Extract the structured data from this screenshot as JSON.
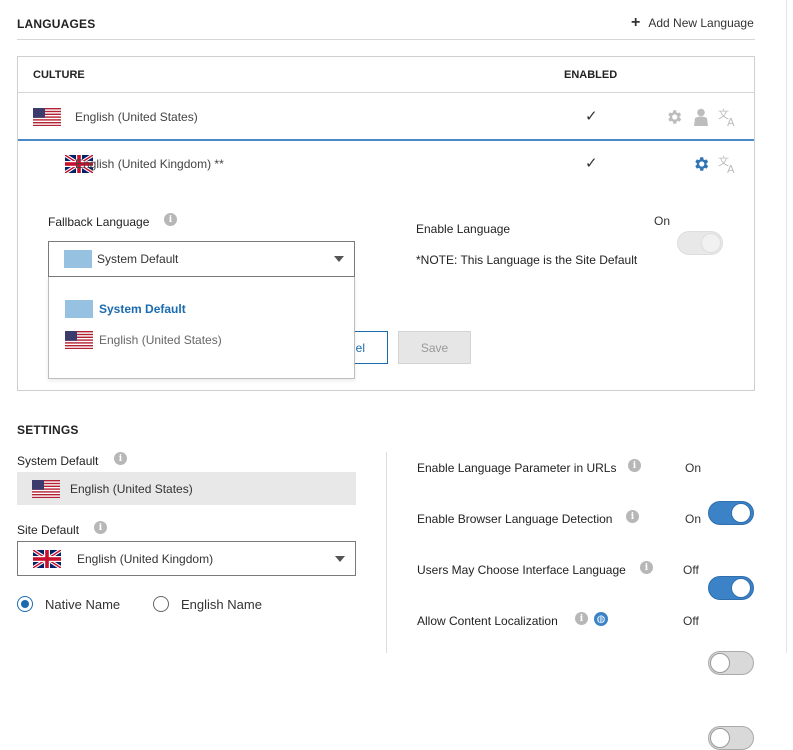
{
  "languages": {
    "section_title": "LANGUAGES",
    "add_button_label": "Add New Language",
    "columns": {
      "culture": "CULTURE",
      "enabled": "ENABLED"
    },
    "rows": [
      {
        "name": "English (United States)",
        "enabled_mark": "✓",
        "flag": "us-flag"
      },
      {
        "name": "English (United Kingdom) **",
        "enabled_mark": "✓",
        "flag": "uk-flag"
      }
    ]
  },
  "editor": {
    "fallback_label": "Fallback Language",
    "fallback_value": "System Default",
    "dropdown_options": [
      "System Default",
      "English (United States)"
    ],
    "enable_language_label": "Enable Language",
    "enable_toggle_label": "On",
    "note": "*NOTE: This Language is the Site Default",
    "cancel_label_partial": "el",
    "save_label": "Save"
  },
  "settings": {
    "section_title": "SETTINGS",
    "system_default_label": "System Default",
    "system_default_value": "English (United States)",
    "site_default_label": "Site Default",
    "site_default_value": "English (United Kingdom)",
    "radio_native_label": "Native Name",
    "radio_english_label": "English Name",
    "toggles": [
      {
        "label": "Enable Language Parameter in URLs",
        "state": "On"
      },
      {
        "label": "Enable Browser Language Detection",
        "state": "On"
      },
      {
        "label": "Users May Choose Interface Language",
        "state": "Off"
      },
      {
        "label": "Allow Content Localization",
        "state": "Off"
      }
    ]
  },
  "colors": {
    "accent": "#3b82c6",
    "accent_dark": "#1a6bb0",
    "swatch": "#96c1e0",
    "toggle_off": "#d9d9d9"
  }
}
